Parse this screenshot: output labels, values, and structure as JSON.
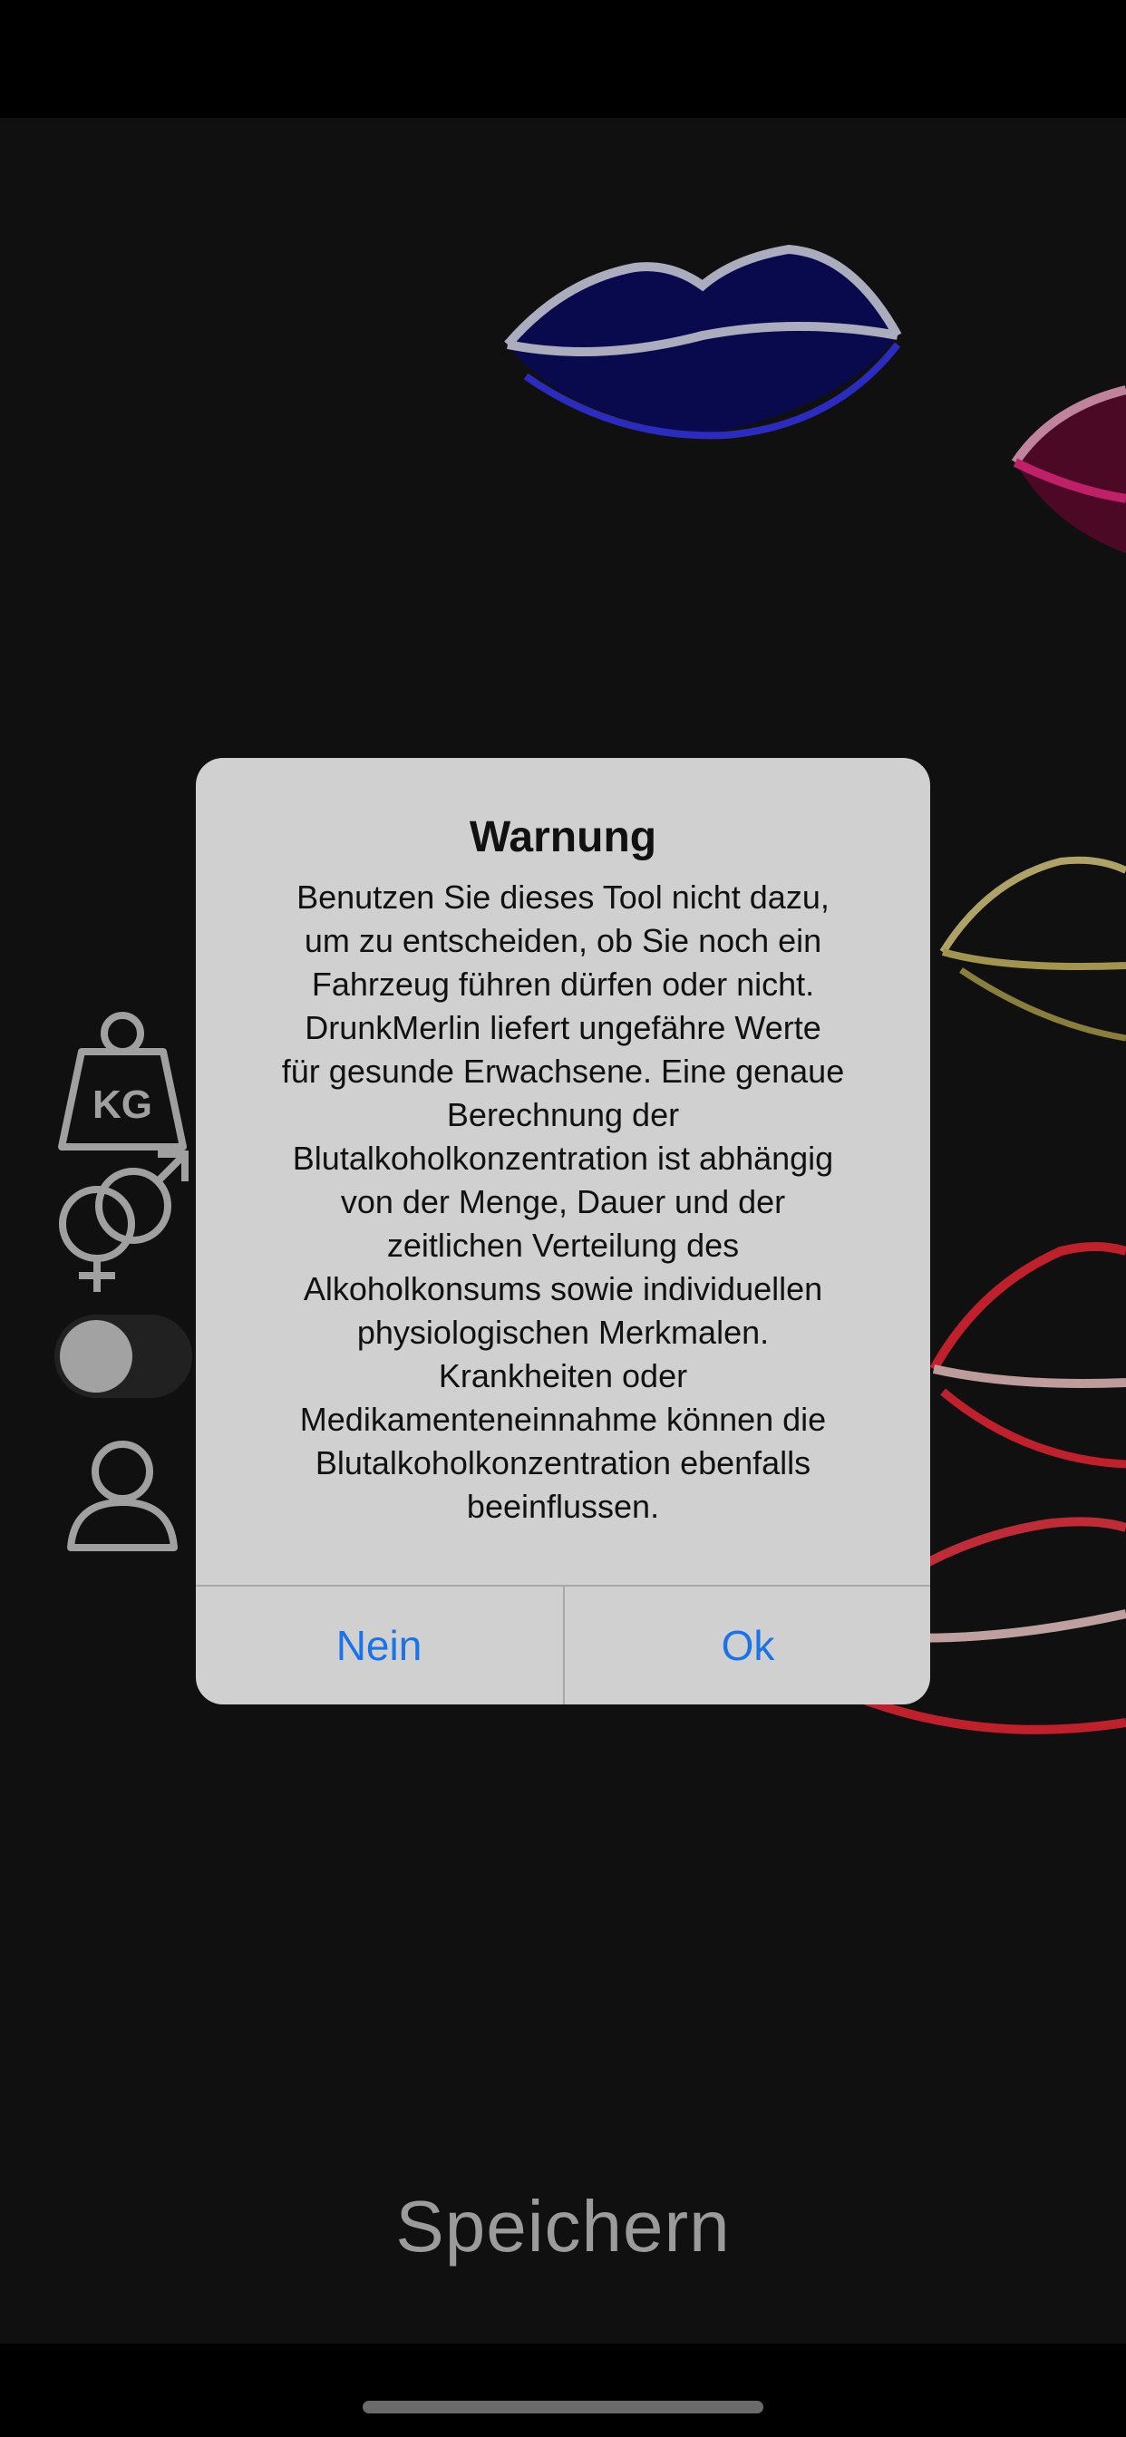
{
  "dialog": {
    "title": "Warnung",
    "message_lines": [
      "Benutzen Sie dieses Tool nicht dazu,",
      "um zu entscheiden, ob Sie noch ein",
      "Fahrzeug führen dürfen oder nicht.",
      "DrunkMerlin liefert ungefähre Werte",
      "für gesunde Erwachsene. Eine genaue",
      "Berechnung der",
      "Blutalkoholkonzentration ist abhängig",
      "von der Menge, Dauer und der",
      "zeitlichen Verteilung des",
      "Alkoholkonsums sowie individuellen",
      "physiologischen Merkmalen.",
      "Krankheiten oder",
      "Medikamenteneinnahme können die",
      "Blutalkoholkonzentration ebenfalls",
      "beeinflussen."
    ],
    "cancel_label": "Nein",
    "ok_label": "Ok"
  },
  "sidebar": {
    "weight_icon_text": "KG",
    "icons": [
      "weight-kg-icon",
      "gender-icon",
      "toggle-switch",
      "person-icon"
    ]
  },
  "save_label": "Speichern",
  "colors": {
    "accent": "#1a73e8",
    "neon_blue": "#3a3aff",
    "neon_pink": "#ff2b8a",
    "neon_yellow": "#d8c76a",
    "neon_red": "#ff2b3a"
  }
}
